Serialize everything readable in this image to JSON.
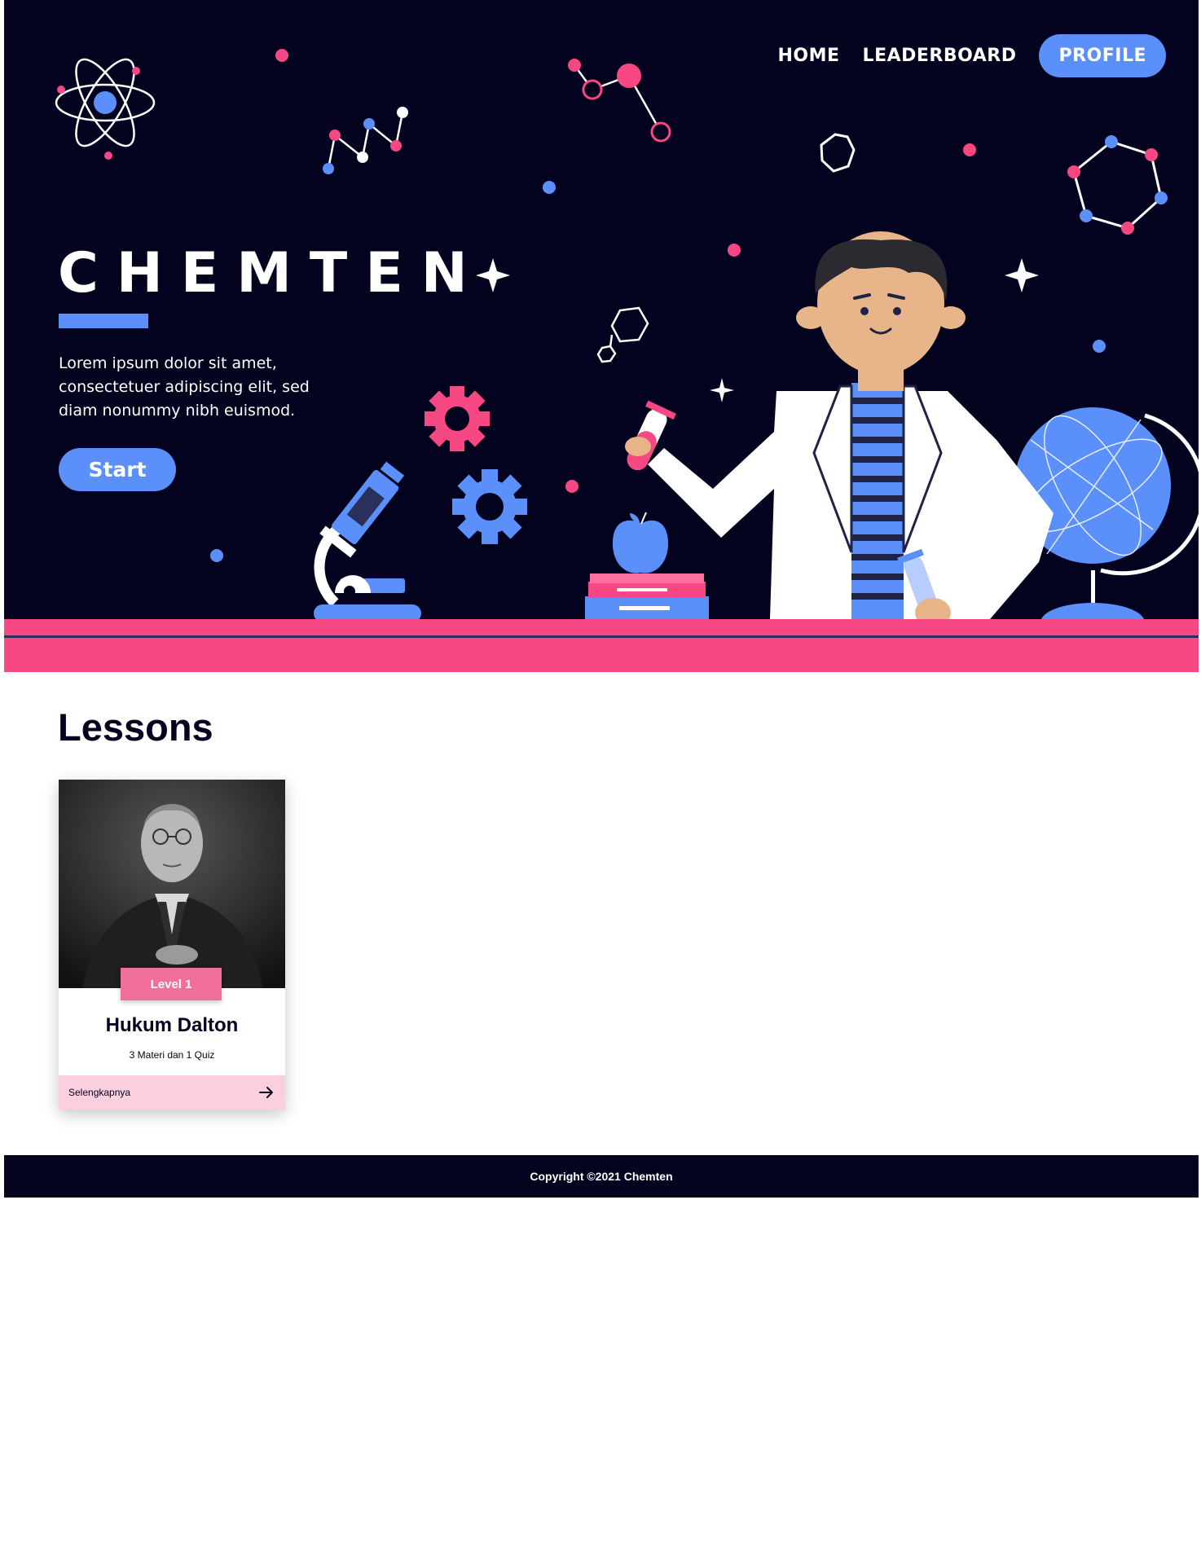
{
  "nav": {
    "home": "HOME",
    "leaderboard": "LEADERBOARD",
    "profile": "PROFILE"
  },
  "hero": {
    "brand": "CHEMTEN",
    "tagline": "Lorem ipsum dolor sit amet, consectetuer adipiscing elit, sed diam nonummy nibh euismod.",
    "start_label": "Start"
  },
  "lessons": {
    "title": "Lessons",
    "cards": [
      {
        "level": "Level 1",
        "title": "Hukum Dalton",
        "subtitle": "3 Materi dan 1 Quiz",
        "link_label": "Selengkapnya",
        "image": "portrait-photo"
      }
    ]
  },
  "footer": {
    "copyright": "Copyright ©2021 Chemten"
  },
  "colors": {
    "navy": "#03021f",
    "blue": "#5b8ff9",
    "pink": "#f74884",
    "light_pink": "#fbcfdd",
    "badge_pink": "#f0709a"
  }
}
